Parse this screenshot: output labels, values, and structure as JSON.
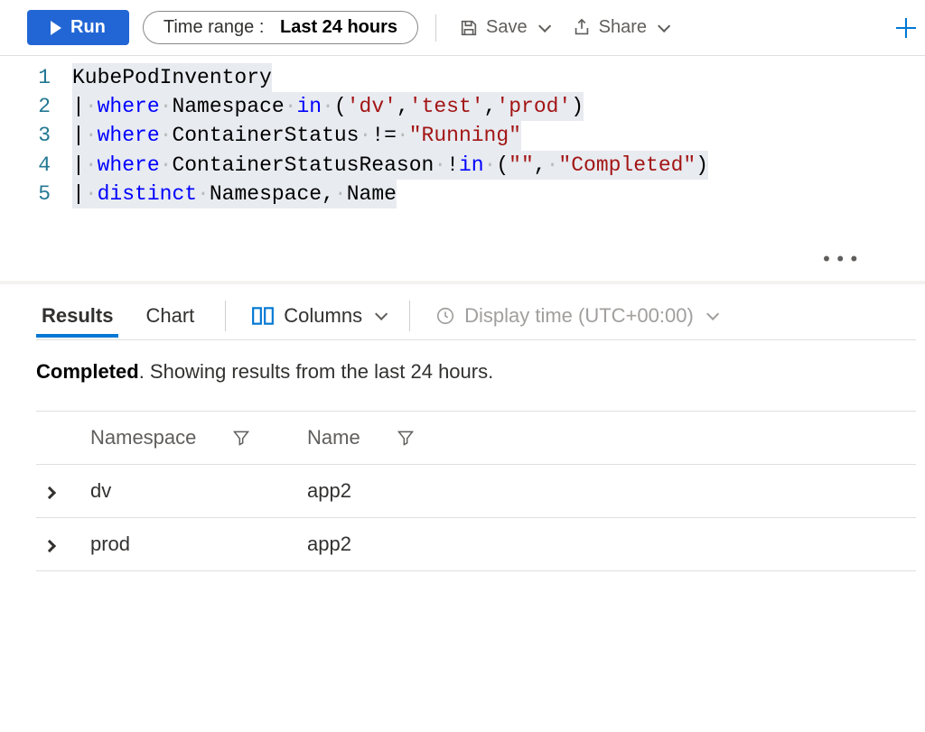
{
  "toolbar": {
    "run_label": "Run",
    "time_range_label": "Time range :",
    "time_range_value": "Last 24 hours",
    "save_label": "Save",
    "share_label": "Share"
  },
  "editor": {
    "lines": [
      {
        "num": "1",
        "tokens": [
          {
            "t": "KubePodInventory",
            "c": "tok-id"
          }
        ]
      },
      {
        "num": "2",
        "tokens": [
          {
            "t": "|",
            "c": "tok-pipe"
          },
          {
            "t": "·",
            "c": "tok-ws"
          },
          {
            "t": "where",
            "c": "tok-kw"
          },
          {
            "t": "·",
            "c": "tok-ws"
          },
          {
            "t": "Namespace",
            "c": "tok-id"
          },
          {
            "t": "·",
            "c": "tok-ws"
          },
          {
            "t": "in",
            "c": "tok-kw"
          },
          {
            "t": "·",
            "c": "tok-ws"
          },
          {
            "t": "(",
            "c": "tok-op"
          },
          {
            "t": "'dv'",
            "c": "tok-str"
          },
          {
            "t": ",",
            "c": "tok-op"
          },
          {
            "t": "'test'",
            "c": "tok-str"
          },
          {
            "t": ",",
            "c": "tok-op"
          },
          {
            "t": "'prod'",
            "c": "tok-str"
          },
          {
            "t": ")",
            "c": "tok-op"
          }
        ]
      },
      {
        "num": "3",
        "tokens": [
          {
            "t": "|",
            "c": "tok-pipe"
          },
          {
            "t": "·",
            "c": "tok-ws"
          },
          {
            "t": "where",
            "c": "tok-kw"
          },
          {
            "t": "·",
            "c": "tok-ws"
          },
          {
            "t": "ContainerStatus",
            "c": "tok-id"
          },
          {
            "t": "·",
            "c": "tok-ws"
          },
          {
            "t": "!=",
            "c": "tok-op"
          },
          {
            "t": "·",
            "c": "tok-ws"
          },
          {
            "t": "\"Running\"",
            "c": "tok-str"
          }
        ]
      },
      {
        "num": "4",
        "tokens": [
          {
            "t": "|",
            "c": "tok-pipe"
          },
          {
            "t": "·",
            "c": "tok-ws"
          },
          {
            "t": "where",
            "c": "tok-kw"
          },
          {
            "t": "·",
            "c": "tok-ws"
          },
          {
            "t": "ContainerStatusReason",
            "c": "tok-id"
          },
          {
            "t": "·",
            "c": "tok-ws"
          },
          {
            "t": "!",
            "c": "tok-op"
          },
          {
            "t": "in",
            "c": "tok-kw"
          },
          {
            "t": "·",
            "c": "tok-ws"
          },
          {
            "t": "(",
            "c": "tok-op"
          },
          {
            "t": "\"\"",
            "c": "tok-str"
          },
          {
            "t": ",",
            "c": "tok-op"
          },
          {
            "t": "·",
            "c": "tok-ws"
          },
          {
            "t": "\"Completed\"",
            "c": "tok-str"
          },
          {
            "t": ")",
            "c": "tok-op"
          }
        ]
      },
      {
        "num": "5",
        "tokens": [
          {
            "t": "|",
            "c": "tok-pipe"
          },
          {
            "t": "·",
            "c": "tok-ws"
          },
          {
            "t": "distinct",
            "c": "tok-kw"
          },
          {
            "t": "·",
            "c": "tok-ws"
          },
          {
            "t": "Namespace",
            "c": "tok-id"
          },
          {
            "t": ",",
            "c": "tok-op"
          },
          {
            "t": "·",
            "c": "tok-ws"
          },
          {
            "t": "Name",
            "c": "tok-id"
          }
        ]
      }
    ]
  },
  "results": {
    "tabs": {
      "results": "Results",
      "chart": "Chart"
    },
    "columns_label": "Columns",
    "display_time_label": "Display time (UTC+00:00)",
    "status_strong": "Completed",
    "status_rest": ". Showing results from the last 24 hours.",
    "headers": {
      "namespace": "Namespace",
      "name": "Name"
    },
    "rows": [
      {
        "namespace": "dv",
        "name": "app2"
      },
      {
        "namespace": "prod",
        "name": "app2"
      }
    ]
  }
}
